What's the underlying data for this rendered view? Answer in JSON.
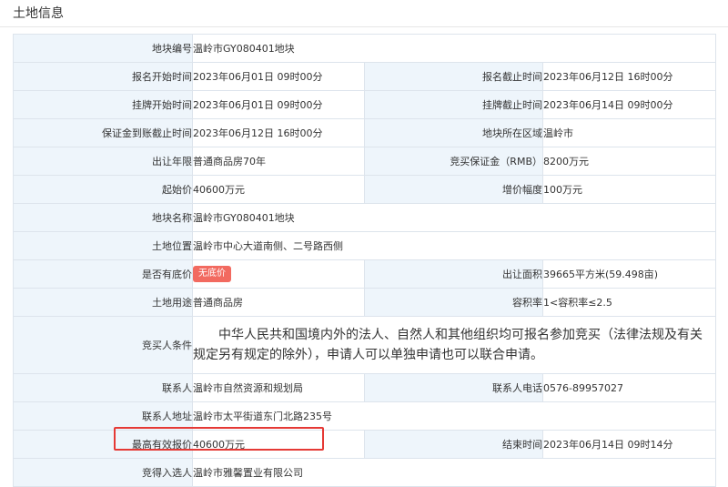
{
  "section": {
    "title": "土地信息"
  },
  "rows": {
    "parcel_no": {
      "label": "地块编号",
      "value": "温岭市GY080401地块"
    },
    "reg_start": {
      "label": "报名开始时间",
      "value": "2023年06月01日 09时00分"
    },
    "reg_end": {
      "label": "报名截止时间",
      "value": "2023年06月12日 16时00分"
    },
    "list_start": {
      "label": "挂牌开始时间",
      "value": "2023年06月01日 09时00分"
    },
    "list_end": {
      "label": "挂牌截止时间",
      "value": "2023年06月14日 09时00分"
    },
    "deposit_deadline": {
      "label": "保证金到账截止时间",
      "value": "2023年06月12日 16时00分"
    },
    "region": {
      "label": "地块所在区域",
      "value": "温岭市"
    },
    "term": {
      "label": "出让年限",
      "value": "普通商品房70年"
    },
    "deposit": {
      "label": "竞买保证金（RMB）",
      "value": "8200万元"
    },
    "start_price": {
      "label": "起始价",
      "value": "40600万元"
    },
    "increment": {
      "label": "增价幅度",
      "value": "100万元"
    },
    "parcel_name": {
      "label": "地块名称",
      "value": "温岭市GY080401地块"
    },
    "location": {
      "label": "土地位置",
      "value": "温岭市中心大道南侧、二号路西侧"
    },
    "reserve": {
      "label": "是否有底价",
      "value": "无底价"
    },
    "area": {
      "label": "出让面积",
      "value": "39665平方米(59.498亩)"
    },
    "usage": {
      "label": "土地用途",
      "value": "普通商品房"
    },
    "far": {
      "label": "容积率",
      "value": "1<容积率≤2.5"
    },
    "conditions": {
      "label": "竞买人条件",
      "value": "中华人民共和国境内外的法人、自然人和其他组织均可报名参加竞买（法律法规及有关规定另有规定的除外），申请人可以单独申请也可以联合申请。"
    },
    "contact": {
      "label": "联系人",
      "value": "温岭市自然资源和规划局"
    },
    "phone": {
      "label": "联系人电话",
      "value": "0576-89957027"
    },
    "address": {
      "label": "联系人地址",
      "value": "温岭市太平街道东门北路235号"
    },
    "max_bid": {
      "label": "最高有效报价",
      "value": "40600万元"
    },
    "end_time": {
      "label": "结束时间",
      "value": "2023年06月14日 09时14分"
    },
    "winner": {
      "label": "竞得入选人",
      "value": "温岭市雅馨置业有限公司"
    }
  },
  "colors": {
    "label_bg": "#eef5fb",
    "border": "#dde4ec",
    "badge": "#f26a60",
    "highlight": "#e53935"
  }
}
